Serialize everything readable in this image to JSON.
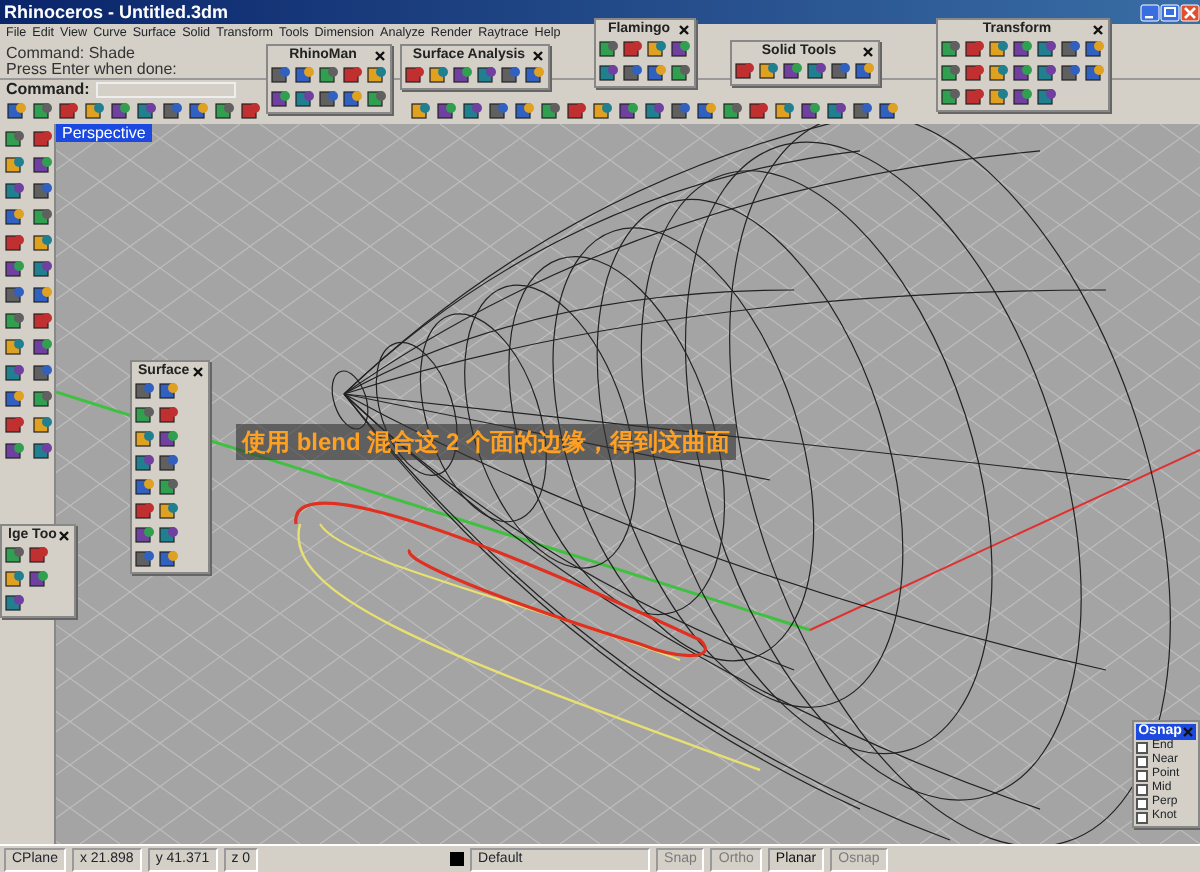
{
  "window": {
    "title": "Rhinoceros - Untitled.3dm"
  },
  "menu": [
    "File",
    "Edit",
    "View",
    "Curve",
    "Surface",
    "Solid",
    "Transform",
    "Tools",
    "Dimension",
    "Analyze",
    "Render",
    "Raytrace",
    "Help"
  ],
  "command_history": [
    "Command: Shade",
    "Press Enter when done:"
  ],
  "command_prompt": "Command:",
  "viewport": {
    "tab": "Perspective",
    "annotation": "使用 blend 混合这 2 个面的边缘，得到这曲面"
  },
  "floating_toolbars": [
    {
      "title": "RhinoMan"
    },
    {
      "title": "Surface Analysis"
    },
    {
      "title": "Flamingo"
    },
    {
      "title": "Solid Tools"
    },
    {
      "title": "Transform"
    },
    {
      "title": "Surface"
    },
    {
      "title": "lge Too"
    }
  ],
  "osnap": {
    "title": "Osnap",
    "items": [
      {
        "label": "End",
        "checked": false
      },
      {
        "label": "Near",
        "checked": false
      },
      {
        "label": "Point",
        "checked": false
      },
      {
        "label": "Mid",
        "checked": false
      },
      {
        "label": "Perp",
        "checked": false
      },
      {
        "label": "Knot",
        "checked": false
      }
    ]
  },
  "status_bar": {
    "cplane": "CPlane",
    "x": "x 21.898",
    "y": "y 41.371",
    "z": "z 0",
    "layer": "Default",
    "toggles": [
      {
        "label": "Snap",
        "on": false
      },
      {
        "label": "Ortho",
        "on": false
      },
      {
        "label": "Planar",
        "on": true
      },
      {
        "label": "Osnap",
        "on": false
      }
    ]
  }
}
